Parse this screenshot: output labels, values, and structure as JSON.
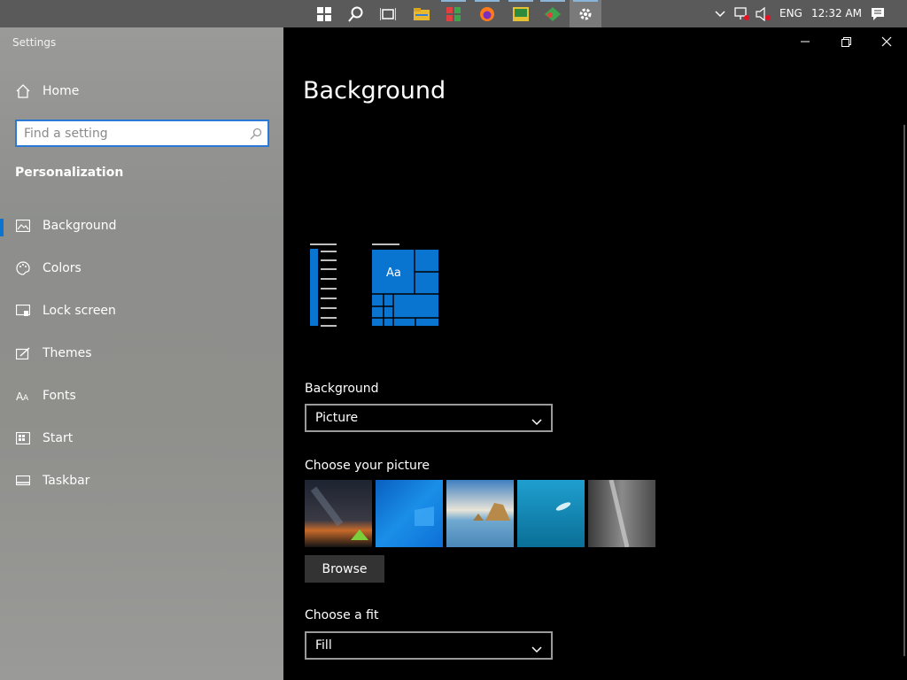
{
  "taskbar": {
    "language": "ENG",
    "time": "12:32 AM",
    "icons": [
      "start-icon",
      "search-icon",
      "task-view-icon",
      "file-explorer-icon",
      "app-icon",
      "firefox-icon",
      "image-app-icon",
      "app-icon-green",
      "settings-icon"
    ]
  },
  "left": {
    "app_title": "Settings",
    "home_label": "Home",
    "search_placeholder": "Find a setting",
    "section_title": "Personalization",
    "items": [
      {
        "label": "Background",
        "icon": "picture-icon"
      },
      {
        "label": "Colors",
        "icon": "palette-icon"
      },
      {
        "label": "Lock screen",
        "icon": "lock-screen-icon"
      },
      {
        "label": "Themes",
        "icon": "brush-icon"
      },
      {
        "label": "Fonts",
        "icon": "fonts-icon"
      },
      {
        "label": "Start",
        "icon": "start-menu-icon"
      },
      {
        "label": "Taskbar",
        "icon": "taskbar-icon"
      }
    ]
  },
  "main": {
    "title": "Background",
    "preview_tile_text": "Aa",
    "background_label": "Background",
    "background_value": "Picture",
    "choose_picture_label": "Choose your picture",
    "browse_label": "Browse",
    "choose_fit_label": "Choose a fit",
    "fit_value": "Fill"
  },
  "colors": {
    "accent": "#0a74d1",
    "left_pane": "#8f8f8c",
    "content_bg": "#000000",
    "taskbar": "#5a5a5a"
  }
}
